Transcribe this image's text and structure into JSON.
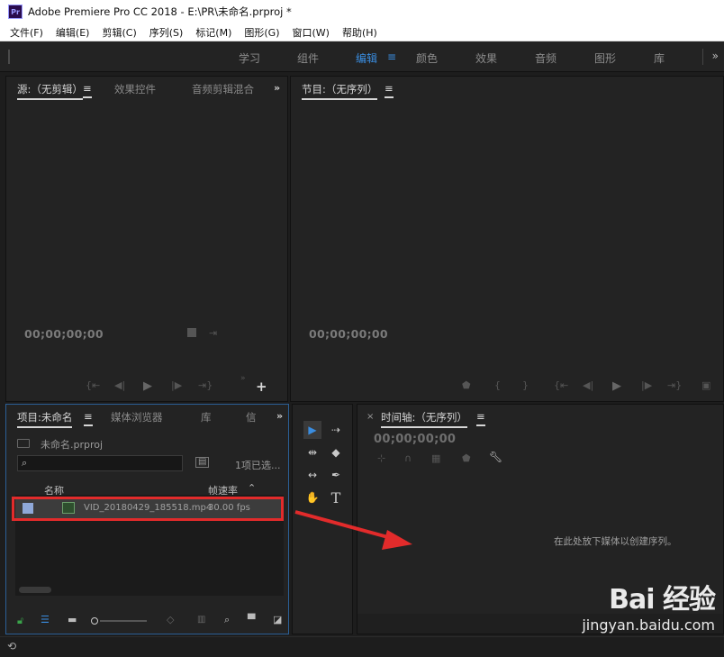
{
  "window": {
    "logo_text": "Pr",
    "title": "Adobe Premiere Pro CC 2018 - E:\\PR\\未命名.prproj *"
  },
  "menu": [
    "文件(F)",
    "编辑(E)",
    "剪辑(C)",
    "序列(S)",
    "标记(M)",
    "图形(G)",
    "窗口(W)",
    "帮助(H)"
  ],
  "workspaces": {
    "tabs": [
      "学习",
      "组件",
      "编辑",
      "颜色",
      "效果",
      "音频",
      "图形",
      "库"
    ],
    "active": "编辑",
    "active_menu_glyph": "≡",
    "more": "»"
  },
  "source_panel": {
    "tabs": [
      "源:（无剪辑）",
      "效果控件",
      "音频剪辑混合"
    ],
    "tab_menu_glyph": "≡",
    "more": "»",
    "timecode": "00;00;00;00",
    "add_glyph": "+"
  },
  "program_panel": {
    "tab": "节目:（无序列）",
    "tab_menu_glyph": "≡",
    "timecode": "00;00;00;00"
  },
  "project_panel": {
    "tabs": [
      "项目:未命名",
      "媒体浏览器",
      "库",
      "信"
    ],
    "tab_menu_glyph": "≡",
    "more": "»",
    "project_file": "未命名.prproj",
    "selection_count": "1项已选...",
    "columns": {
      "name": "名称",
      "frame_rate": "帧速率"
    },
    "items": [
      {
        "name": "VID_20180429_185518.mp4",
        "fps": "30.00 fps"
      }
    ]
  },
  "timeline_panel": {
    "close_glyph": "×",
    "tab": "时间轴:（无序列）",
    "tab_menu_glyph": "≡",
    "timecode": "00;00;00;00",
    "drop_hint": "在此处放下媒体以创建序列。"
  },
  "watermark": {
    "logo": "Bai 经验",
    "url": "jingyan.baidu.com"
  },
  "colors": {
    "accent": "#3a8de0",
    "highlight": "#e22b2b",
    "panel_bg": "#232323"
  }
}
